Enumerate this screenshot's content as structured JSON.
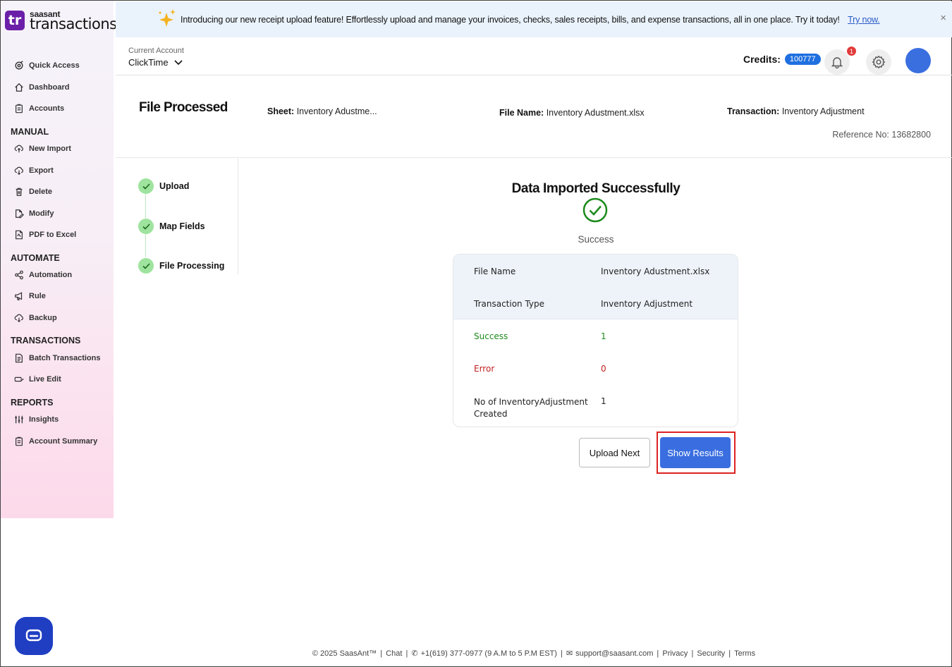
{
  "app": {
    "logo_mark": "tr",
    "logo_small": "saasant",
    "logo_big": "transactions"
  },
  "banner": {
    "text": "Introducing our new receipt upload feature! Effortlessly upload and manage your invoices, checks, sales receipts, bills, and expense transactions, all in one place. Try it today!",
    "link": "Try now.",
    "close": "×"
  },
  "sidebar": {
    "top_items": [
      {
        "label": "Quick Access",
        "icon": "quick-access-icon"
      },
      {
        "label": "Dashboard",
        "icon": "home-icon"
      },
      {
        "label": "Accounts",
        "icon": "clipboard-icon"
      }
    ],
    "sections": [
      {
        "title": "MANUAL",
        "items": [
          {
            "label": "New Import",
            "icon": "cloud-upload-icon"
          },
          {
            "label": "Export",
            "icon": "cloud-download-icon"
          },
          {
            "label": "Delete",
            "icon": "trash-icon"
          },
          {
            "label": "Modify",
            "icon": "edit-file-icon"
          },
          {
            "label": "PDF to Excel",
            "icon": "pdf-file-icon"
          }
        ]
      },
      {
        "title": "AUTOMATE",
        "items": [
          {
            "label": "Automation",
            "icon": "share-nodes-icon"
          },
          {
            "label": "Rule",
            "icon": "megaphone-icon"
          },
          {
            "label": "Backup",
            "icon": "cloud-backup-icon"
          }
        ]
      },
      {
        "title": "TRANSACTIONS",
        "items": [
          {
            "label": "Batch Transactions",
            "icon": "document-icon"
          },
          {
            "label": "Live Edit",
            "icon": "live-edit-icon"
          }
        ]
      },
      {
        "title": "REPORTS",
        "items": [
          {
            "label": "Insights",
            "icon": "sliders-icon"
          },
          {
            "label": "Account Summary",
            "icon": "clipboard-list-icon"
          }
        ]
      }
    ]
  },
  "header": {
    "account_label": "Current Account",
    "account_value": "ClickTime",
    "credits_label": "Credits:",
    "credits_value": "100777",
    "notification_count": "1"
  },
  "info": {
    "title": "File Processed",
    "sheet_label": "Sheet:",
    "sheet_value": "Inventory Adustme...",
    "file_label": "File Name:",
    "file_value": "Inventory Adustment.xlsx",
    "transaction_label": "Transaction:",
    "transaction_value": "Inventory Adjustment",
    "reference": "Reference No: 13682800"
  },
  "steps": [
    "Upload",
    "Map Fields",
    "File Processing"
  ],
  "result": {
    "title": "Data Imported Successfully",
    "status": "Success",
    "rows": [
      {
        "label": "File Name",
        "value": "Inventory Adustment.xlsx"
      },
      {
        "label": "Transaction Type",
        "value": "Inventory Adjustment"
      },
      {
        "label": "Success",
        "value": "1"
      },
      {
        "label": "Error",
        "value": "0"
      },
      {
        "label": "No of InventoryAdjustment Created",
        "value": "1"
      }
    ],
    "upload_next": "Upload Next",
    "show_results": "Show Results"
  },
  "footer": {
    "copyright": "© 2025 SaasAnt™",
    "chat": "Chat",
    "phone": "+1(619) 377-0977 (9 A.M to 5 P.M EST)",
    "email": "support@saasant.com",
    "privacy": "Privacy",
    "security": "Security",
    "terms": "Terms"
  },
  "colors": {
    "accent": "#3a6ee0",
    "success": "#1c8a1c",
    "error": "#c01f1f",
    "logo": "#6b1fa8"
  }
}
